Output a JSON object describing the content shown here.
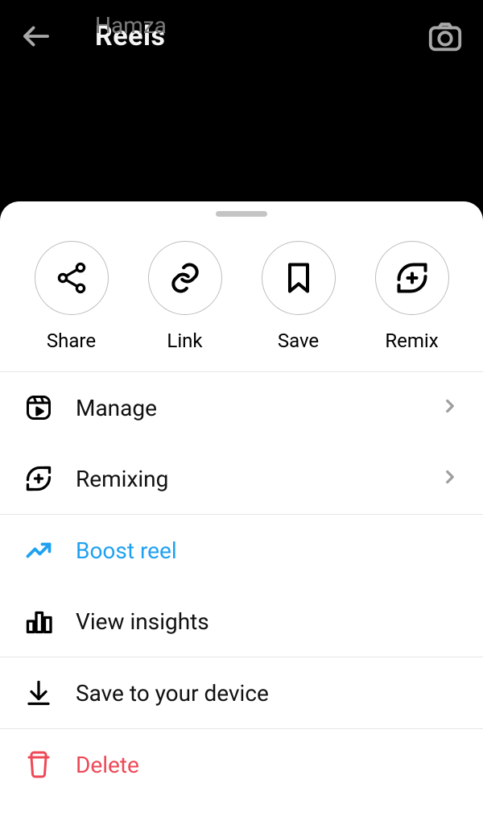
{
  "header": {
    "title": "Reels",
    "subtitle": "Hamza"
  },
  "actions": {
    "share": {
      "label": "Share"
    },
    "link": {
      "label": "Link"
    },
    "save": {
      "label": "Save"
    },
    "remix": {
      "label": "Remix"
    }
  },
  "menu": {
    "manage": {
      "label": "Manage"
    },
    "remixing": {
      "label": "Remixing"
    },
    "boost": {
      "label": "Boost reel"
    },
    "insights": {
      "label": "View insights"
    },
    "saveDevice": {
      "label": "Save to your device"
    },
    "delete": {
      "label": "Delete"
    }
  }
}
